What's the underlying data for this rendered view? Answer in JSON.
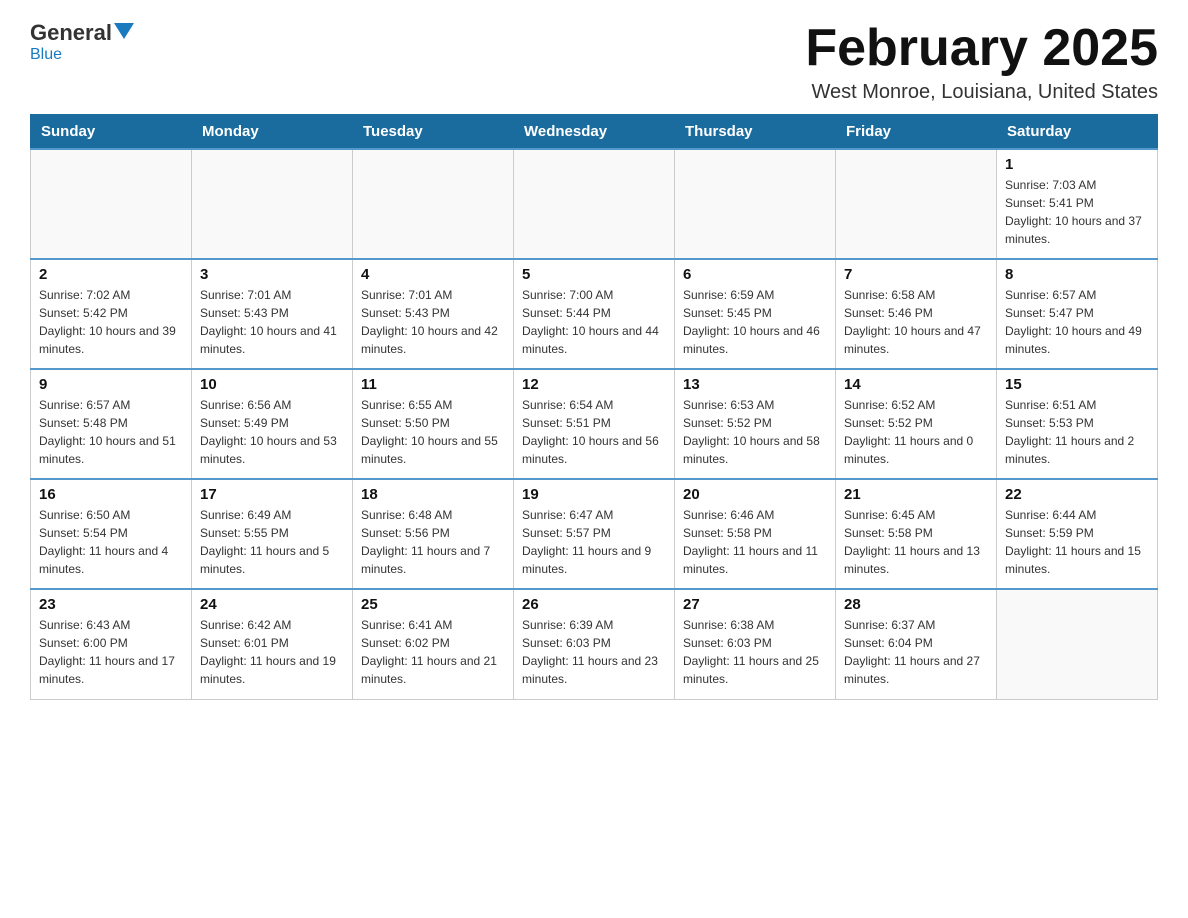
{
  "header": {
    "logo_general": "General",
    "logo_blue": "Blue",
    "month_title": "February 2025",
    "location": "West Monroe, Louisiana, United States"
  },
  "days_of_week": [
    "Sunday",
    "Monday",
    "Tuesday",
    "Wednesday",
    "Thursday",
    "Friday",
    "Saturday"
  ],
  "weeks": [
    {
      "days": [
        {
          "number": "",
          "info": ""
        },
        {
          "number": "",
          "info": ""
        },
        {
          "number": "",
          "info": ""
        },
        {
          "number": "",
          "info": ""
        },
        {
          "number": "",
          "info": ""
        },
        {
          "number": "",
          "info": ""
        },
        {
          "number": "1",
          "info": "Sunrise: 7:03 AM\nSunset: 5:41 PM\nDaylight: 10 hours and 37 minutes."
        }
      ]
    },
    {
      "days": [
        {
          "number": "2",
          "info": "Sunrise: 7:02 AM\nSunset: 5:42 PM\nDaylight: 10 hours and 39 minutes."
        },
        {
          "number": "3",
          "info": "Sunrise: 7:01 AM\nSunset: 5:43 PM\nDaylight: 10 hours and 41 minutes."
        },
        {
          "number": "4",
          "info": "Sunrise: 7:01 AM\nSunset: 5:43 PM\nDaylight: 10 hours and 42 minutes."
        },
        {
          "number": "5",
          "info": "Sunrise: 7:00 AM\nSunset: 5:44 PM\nDaylight: 10 hours and 44 minutes."
        },
        {
          "number": "6",
          "info": "Sunrise: 6:59 AM\nSunset: 5:45 PM\nDaylight: 10 hours and 46 minutes."
        },
        {
          "number": "7",
          "info": "Sunrise: 6:58 AM\nSunset: 5:46 PM\nDaylight: 10 hours and 47 minutes."
        },
        {
          "number": "8",
          "info": "Sunrise: 6:57 AM\nSunset: 5:47 PM\nDaylight: 10 hours and 49 minutes."
        }
      ]
    },
    {
      "days": [
        {
          "number": "9",
          "info": "Sunrise: 6:57 AM\nSunset: 5:48 PM\nDaylight: 10 hours and 51 minutes."
        },
        {
          "number": "10",
          "info": "Sunrise: 6:56 AM\nSunset: 5:49 PM\nDaylight: 10 hours and 53 minutes."
        },
        {
          "number": "11",
          "info": "Sunrise: 6:55 AM\nSunset: 5:50 PM\nDaylight: 10 hours and 55 minutes."
        },
        {
          "number": "12",
          "info": "Sunrise: 6:54 AM\nSunset: 5:51 PM\nDaylight: 10 hours and 56 minutes."
        },
        {
          "number": "13",
          "info": "Sunrise: 6:53 AM\nSunset: 5:52 PM\nDaylight: 10 hours and 58 minutes."
        },
        {
          "number": "14",
          "info": "Sunrise: 6:52 AM\nSunset: 5:52 PM\nDaylight: 11 hours and 0 minutes."
        },
        {
          "number": "15",
          "info": "Sunrise: 6:51 AM\nSunset: 5:53 PM\nDaylight: 11 hours and 2 minutes."
        }
      ]
    },
    {
      "days": [
        {
          "number": "16",
          "info": "Sunrise: 6:50 AM\nSunset: 5:54 PM\nDaylight: 11 hours and 4 minutes."
        },
        {
          "number": "17",
          "info": "Sunrise: 6:49 AM\nSunset: 5:55 PM\nDaylight: 11 hours and 5 minutes."
        },
        {
          "number": "18",
          "info": "Sunrise: 6:48 AM\nSunset: 5:56 PM\nDaylight: 11 hours and 7 minutes."
        },
        {
          "number": "19",
          "info": "Sunrise: 6:47 AM\nSunset: 5:57 PM\nDaylight: 11 hours and 9 minutes."
        },
        {
          "number": "20",
          "info": "Sunrise: 6:46 AM\nSunset: 5:58 PM\nDaylight: 11 hours and 11 minutes."
        },
        {
          "number": "21",
          "info": "Sunrise: 6:45 AM\nSunset: 5:58 PM\nDaylight: 11 hours and 13 minutes."
        },
        {
          "number": "22",
          "info": "Sunrise: 6:44 AM\nSunset: 5:59 PM\nDaylight: 11 hours and 15 minutes."
        }
      ]
    },
    {
      "days": [
        {
          "number": "23",
          "info": "Sunrise: 6:43 AM\nSunset: 6:00 PM\nDaylight: 11 hours and 17 minutes."
        },
        {
          "number": "24",
          "info": "Sunrise: 6:42 AM\nSunset: 6:01 PM\nDaylight: 11 hours and 19 minutes."
        },
        {
          "number": "25",
          "info": "Sunrise: 6:41 AM\nSunset: 6:02 PM\nDaylight: 11 hours and 21 minutes."
        },
        {
          "number": "26",
          "info": "Sunrise: 6:39 AM\nSunset: 6:03 PM\nDaylight: 11 hours and 23 minutes."
        },
        {
          "number": "27",
          "info": "Sunrise: 6:38 AM\nSunset: 6:03 PM\nDaylight: 11 hours and 25 minutes."
        },
        {
          "number": "28",
          "info": "Sunrise: 6:37 AM\nSunset: 6:04 PM\nDaylight: 11 hours and 27 minutes."
        },
        {
          "number": "",
          "info": ""
        }
      ]
    }
  ]
}
